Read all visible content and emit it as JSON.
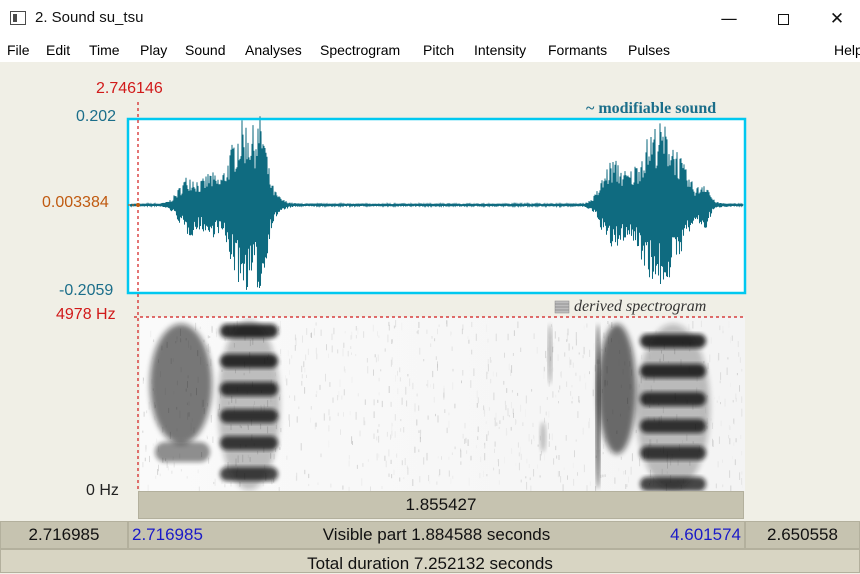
{
  "window": {
    "title": "2. Sound su_tsu",
    "minimize_icon": "minimize-icon",
    "maximize_icon": "maximize-icon",
    "close_icon": "close-icon"
  },
  "menubar": {
    "items": [
      "File",
      "Edit",
      "Time",
      "Play",
      "Sound",
      "Analyses",
      "Spectrogram",
      "Pitch",
      "Intensity",
      "Formants",
      "Pulses",
      "Help"
    ]
  },
  "editor": {
    "cursor_time": "2.746146",
    "waveform": {
      "title": "~ modifiable sound",
      "y_max": "0.202",
      "y_cursor": "0.003384",
      "y_min": "-0.2059",
      "border_color": "#00c8f0",
      "wave_color": "#0f6b80"
    },
    "spectrogram": {
      "title": "derived spectrogram",
      "freq_max": "4978 Hz",
      "freq_min": "0 Hz"
    },
    "selection_duration": "1.855427",
    "visible": {
      "left_outside": "2.716985",
      "start": "2.716985",
      "label": "Visible part 1.884588 seconds",
      "end": "4.601574",
      "right_outside": "2.650558"
    },
    "total_duration": "Total duration 7.252132 seconds"
  }
}
